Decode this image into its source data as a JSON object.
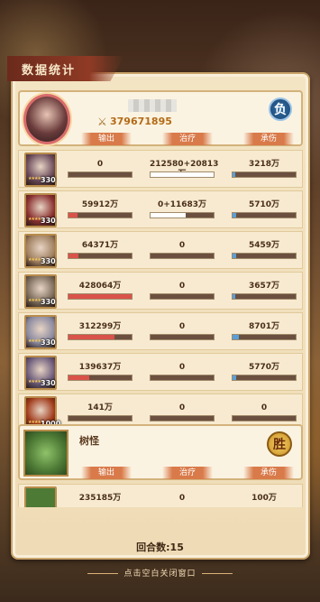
{
  "header": {
    "title": "数据统计"
  },
  "player": {
    "power": "379671895",
    "result": "负",
    "tags": [
      "输出",
      "治疗",
      "承伤"
    ]
  },
  "heroes": [
    {
      "level": "330",
      "damage": "0",
      "heal": "212580+20813万",
      "taken": "3218万",
      "damage_frac": 0.0,
      "heal_frac": 1.0,
      "taken_frac": 0.04,
      "color": "#6a4a5a"
    },
    {
      "level": "330",
      "damage": "59912万",
      "heal": "0+11683万",
      "taken": "5710万",
      "damage_frac": 0.14,
      "heal_frac": 0.55,
      "taken_frac": 0.06,
      "color": "#8a3030"
    },
    {
      "level": "330",
      "damage": "64371万",
      "heal": "0",
      "taken": "5459万",
      "damage_frac": 0.15,
      "heal_frac": 0.0,
      "taken_frac": 0.06,
      "color": "#a08060"
    },
    {
      "level": "330",
      "damage": "428064万",
      "heal": "0",
      "taken": "3657万",
      "damage_frac": 1.0,
      "heal_frac": 0.0,
      "taken_frac": 0.04,
      "color": "#7a6a5a"
    },
    {
      "level": "330",
      "damage": "312299万",
      "heal": "0",
      "taken": "8701万",
      "damage_frac": 0.73,
      "heal_frac": 0.0,
      "taken_frac": 0.1,
      "color": "#8a8aa0"
    },
    {
      "level": "330",
      "damage": "139637万",
      "heal": "0",
      "taken": "5770万",
      "damage_frac": 0.33,
      "heal_frac": 0.0,
      "taken_frac": 0.06,
      "color": "#6a5a7a"
    },
    {
      "level": "1000",
      "damage": "141万",
      "heal": "0",
      "taken": "0",
      "damage_frac": 0.0,
      "heal_frac": 0.0,
      "taken_frac": 0.0,
      "color": "#a03a1a"
    }
  ],
  "enemy": {
    "name": "树怪",
    "result": "胜",
    "tags": [
      "输出",
      "治疗",
      "承伤"
    ]
  },
  "partial_row": {
    "damage": "235185万",
    "heal": "0",
    "taken": "100万"
  },
  "footer": {
    "rounds": "回合数:15",
    "close_hint": "点击空白关闭窗口"
  },
  "colors": {
    "damage_fill": "#d9534a",
    "heal_fill": "#ffffff",
    "taken_fill": "#5aa0d8"
  }
}
